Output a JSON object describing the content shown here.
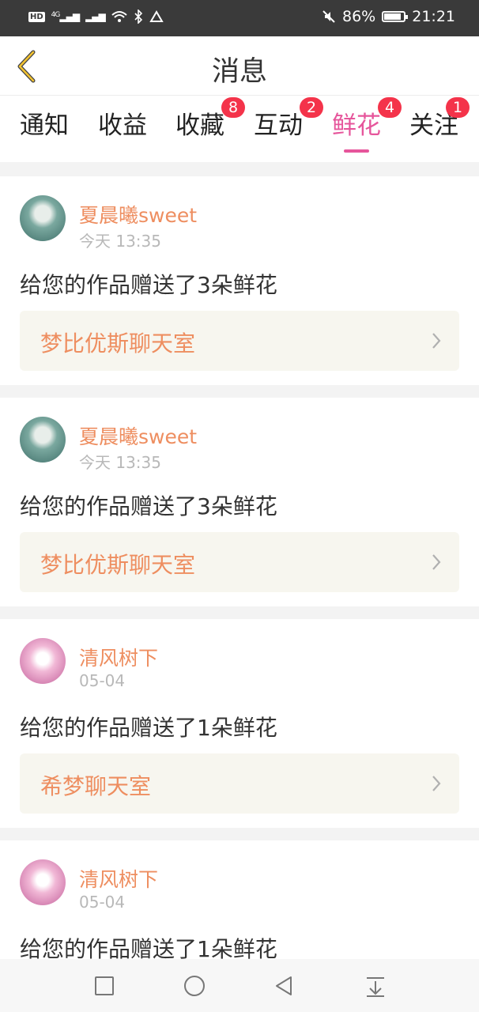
{
  "status_bar": {
    "hd": "HD",
    "network": "4G",
    "battery_percent": "86%",
    "battery_level": 0.86,
    "time": "21:21"
  },
  "header": {
    "title": "消息",
    "back_icon": "chevron-left-icon"
  },
  "tabs": [
    {
      "label": "通知",
      "badge": ""
    },
    {
      "label": "收益",
      "badge": ""
    },
    {
      "label": "收藏",
      "badge": "8"
    },
    {
      "label": "互动",
      "badge": "2"
    },
    {
      "label": "鲜花",
      "badge": "4",
      "active": true
    },
    {
      "label": "关注",
      "badge": "1"
    }
  ],
  "messages": [
    {
      "username": "夏晨曦sweet",
      "time": "今天 13:35",
      "text": "给您的作品赠送了3朵鲜花",
      "room": "梦比优斯聊天室"
    },
    {
      "username": "夏晨曦sweet",
      "time": "今天 13:35",
      "text": "给您的作品赠送了3朵鲜花",
      "room": "梦比优斯聊天室"
    },
    {
      "username": "清风树下",
      "time": "05-04",
      "text": "给您的作品赠送了1朵鲜花",
      "room": "希梦聊天室"
    },
    {
      "username": "清风树下",
      "time": "05-04",
      "text": "给您的作品赠送了1朵鲜花",
      "room": ""
    }
  ],
  "colors": {
    "accent": "#e6559b",
    "username": "#ee8e60",
    "badge": "#f4334a",
    "room_bg": "#f7f6ef"
  },
  "nav": [
    "recent-apps-icon",
    "home-icon",
    "back-icon",
    "notification-pull-icon"
  ]
}
